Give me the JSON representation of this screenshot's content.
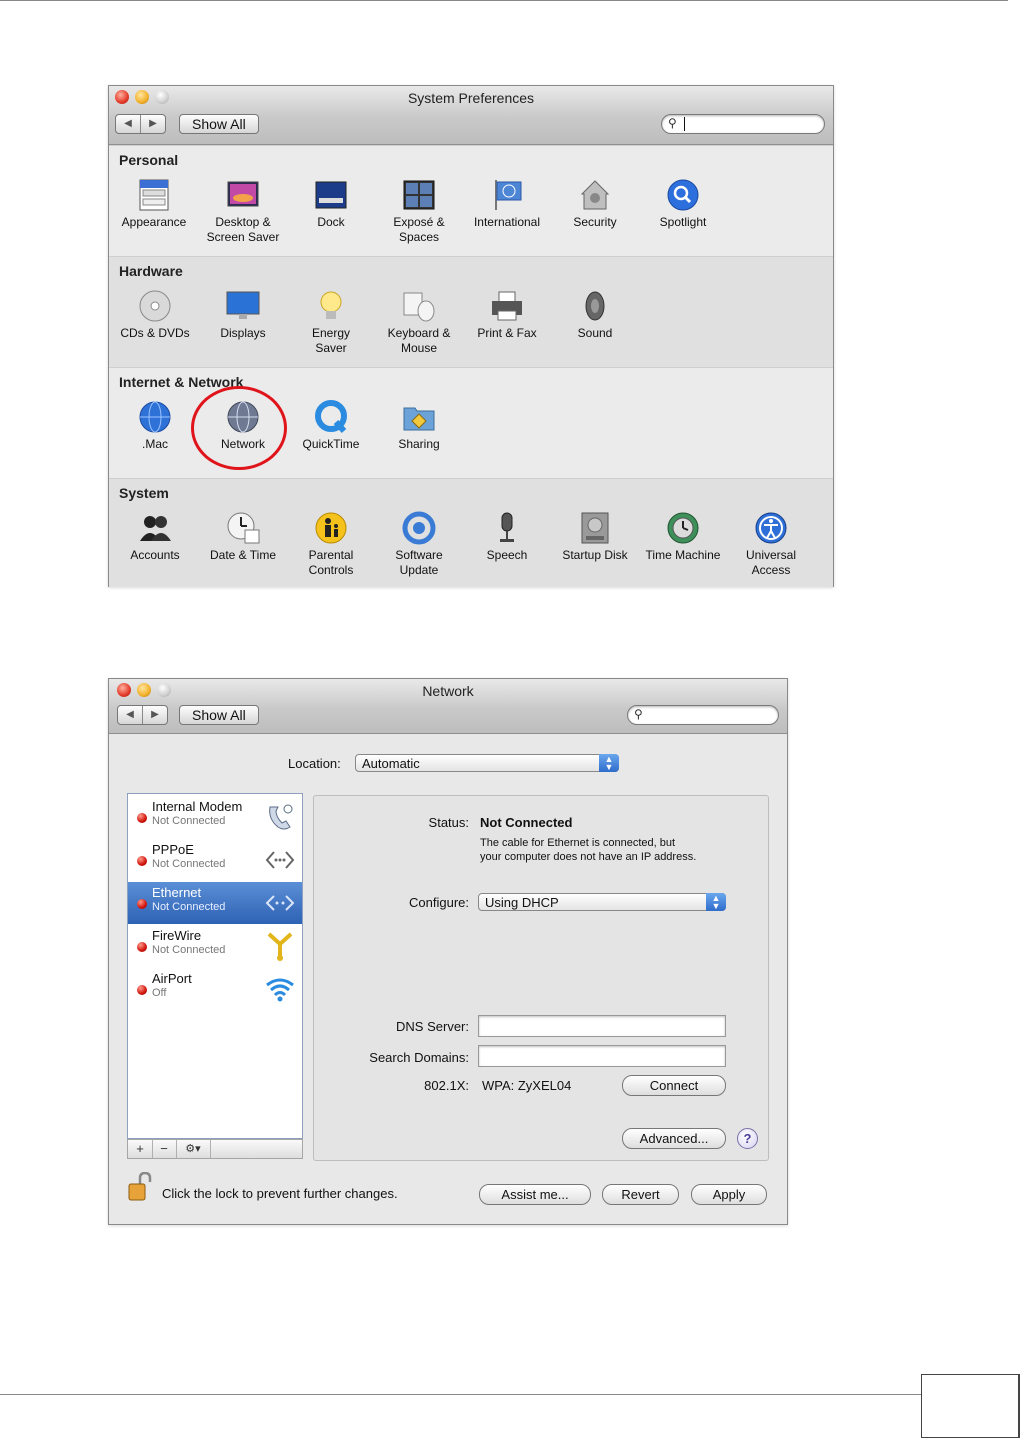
{
  "sysprefs": {
    "title": "System Preferences",
    "show_all": "Show All",
    "sections": [
      {
        "title": "Personal",
        "items": [
          {
            "label": "Appearance",
            "icon": "appearance-icon"
          },
          {
            "label": "Desktop & Screen Saver",
            "icon": "desktop-icon"
          },
          {
            "label": "Dock",
            "icon": "dock-icon"
          },
          {
            "label": "Exposé & Spaces",
            "icon": "expose-icon"
          },
          {
            "label": "International",
            "icon": "international-icon"
          },
          {
            "label": "Security",
            "icon": "security-icon"
          },
          {
            "label": "Spotlight",
            "icon": "spotlight-icon"
          }
        ]
      },
      {
        "title": "Hardware",
        "items": [
          {
            "label": "CDs & DVDs",
            "icon": "cd-icon"
          },
          {
            "label": "Displays",
            "icon": "display-icon"
          },
          {
            "label": "Energy Saver",
            "icon": "energy-icon"
          },
          {
            "label": "Keyboard & Mouse",
            "icon": "keyboard-icon"
          },
          {
            "label": "Print & Fax",
            "icon": "printer-icon"
          },
          {
            "label": "Sound",
            "icon": "speaker-icon"
          }
        ]
      },
      {
        "title": "Internet & Network",
        "items": [
          {
            "label": ".Mac",
            "icon": "mac-globe-icon"
          },
          {
            "label": "Network",
            "icon": "network-globe-icon"
          },
          {
            "label": "QuickTime",
            "icon": "quicktime-icon"
          },
          {
            "label": "Sharing",
            "icon": "sharing-folder-icon"
          }
        ]
      },
      {
        "title": "System",
        "items": [
          {
            "label": "Accounts",
            "icon": "accounts-icon"
          },
          {
            "label": "Date & Time",
            "icon": "clock-icon"
          },
          {
            "label": "Parental Controls",
            "icon": "parental-icon"
          },
          {
            "label": "Software Update",
            "icon": "update-icon"
          },
          {
            "label": "Speech",
            "icon": "microphone-icon"
          },
          {
            "label": "Startup Disk",
            "icon": "disk-icon"
          },
          {
            "label": "Time Machine",
            "icon": "time-machine-icon"
          },
          {
            "label": "Universal Access",
            "icon": "accessibility-icon"
          }
        ]
      }
    ]
  },
  "network": {
    "title": "Network",
    "show_all": "Show All",
    "location_label": "Location:",
    "location_value": "Automatic",
    "services": [
      {
        "name": "Internal Modem",
        "status": "Not Connected",
        "icon": "phone-icon",
        "selected": false
      },
      {
        "name": "PPPoE",
        "status": "Not Connected",
        "icon": "pppoe-icon",
        "selected": false
      },
      {
        "name": "Ethernet",
        "status": "Not Connected",
        "icon": "ethernet-icon",
        "selected": true
      },
      {
        "name": "FireWire",
        "status": "Not Connected",
        "icon": "firewire-icon",
        "selected": false
      },
      {
        "name": "AirPort",
        "status": "Off",
        "icon": "wifi-icon",
        "selected": false
      }
    ],
    "list_buttons": {
      "add": "+",
      "remove": "−",
      "gear": "⚙▾"
    },
    "status_label": "Status:",
    "status_value": "Not Connected",
    "status_desc_1": "The cable for Ethernet is connected, but",
    "status_desc_2": "your computer does not have an IP address.",
    "configure_label": "Configure:",
    "configure_value": "Using DHCP",
    "dns_label": "DNS Server:",
    "search_domains_label": "Search Domains:",
    "dot1x_label": "802.1X:",
    "dot1x_value": "WPA: ZyXEL04",
    "connect_button": "Connect",
    "advanced_button": "Advanced...",
    "help_button": "?",
    "lock_text": "Click the lock to prevent further changes.",
    "assist_button": "Assist me...",
    "revert_button": "Revert",
    "apply_button": "Apply"
  }
}
